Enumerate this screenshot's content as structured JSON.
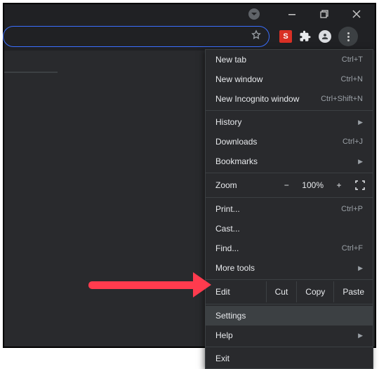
{
  "window": {
    "minimize_tip": "Minimize",
    "maximize_tip": "Maximize",
    "close_tip": "Close"
  },
  "toolbar": {
    "ext_initial": "S"
  },
  "menu": {
    "new_tab": {
      "label": "New tab",
      "shortcut": "Ctrl+T"
    },
    "new_window": {
      "label": "New window",
      "shortcut": "Ctrl+N"
    },
    "new_incognito": {
      "label": "New Incognito window",
      "shortcut": "Ctrl+Shift+N"
    },
    "history": {
      "label": "History"
    },
    "downloads": {
      "label": "Downloads",
      "shortcut": "Ctrl+J"
    },
    "bookmarks": {
      "label": "Bookmarks"
    },
    "zoom": {
      "label": "Zoom",
      "minus": "−",
      "value": "100%",
      "plus": "+"
    },
    "print": {
      "label": "Print...",
      "shortcut": "Ctrl+P"
    },
    "cast": {
      "label": "Cast..."
    },
    "find": {
      "label": "Find...",
      "shortcut": "Ctrl+F"
    },
    "more_tools": {
      "label": "More tools"
    },
    "edit": {
      "label": "Edit",
      "cut": "Cut",
      "copy": "Copy",
      "paste": "Paste"
    },
    "settings": {
      "label": "Settings"
    },
    "help": {
      "label": "Help"
    },
    "exit": {
      "label": "Exit"
    }
  },
  "annotation": {
    "highlight_target": "settings"
  }
}
